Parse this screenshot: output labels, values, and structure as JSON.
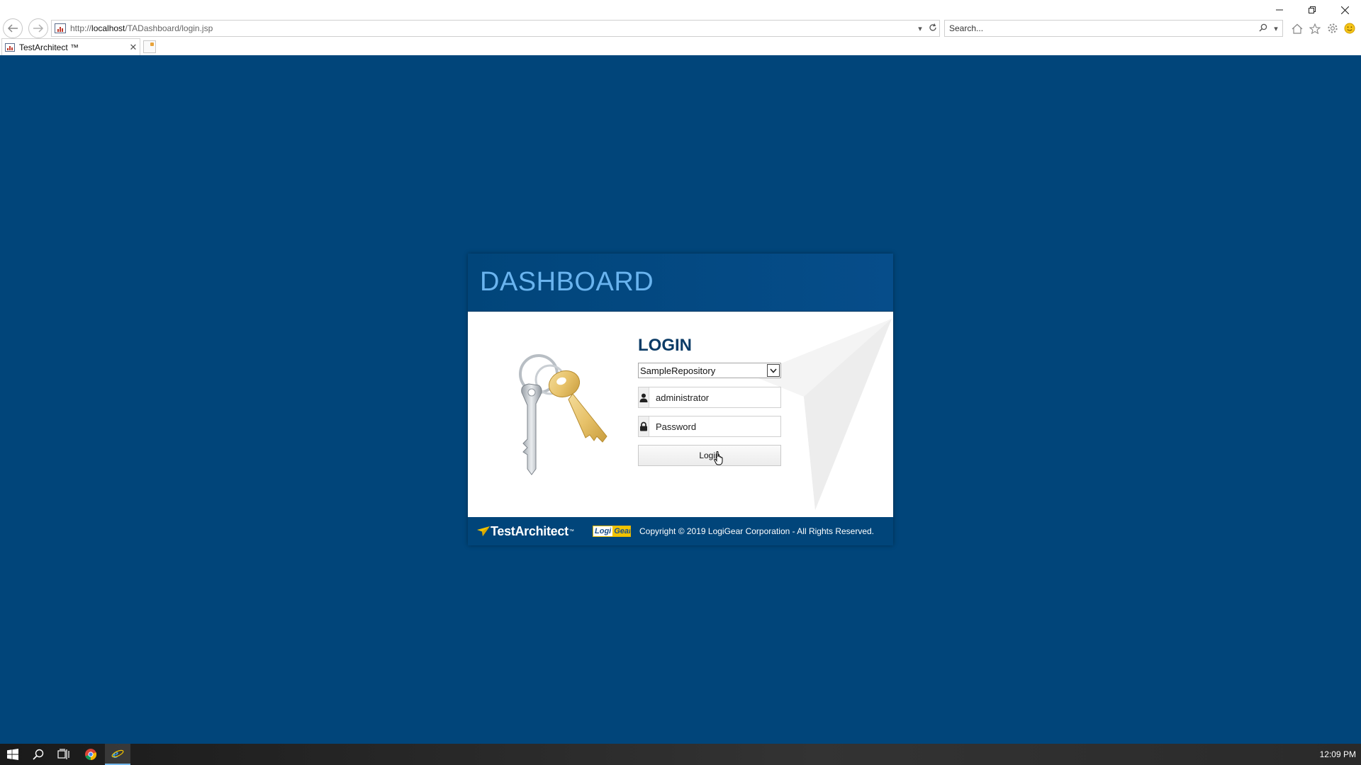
{
  "browser": {
    "url_prefix": "http://",
    "url_host": "localhost",
    "url_path": "/TADashboard/login.jsp",
    "search_placeholder": "Search...",
    "tab_title": "TestArchitect ™"
  },
  "card": {
    "header_title": "DASHBOARD",
    "login_heading": "LOGIN",
    "repository_selected": "SampleRepository",
    "username_value": "administrator",
    "password_placeholder": "Password",
    "login_button": "Login"
  },
  "footer": {
    "ta_logo_text": "TestArchitect",
    "ta_logo_tm": "™",
    "lg_logo_part1": "Logi",
    "lg_logo_part2": "Gear",
    "copyright": "Copyright © 2019 LogiGear Corporation - All Rights Reserved."
  },
  "taskbar": {
    "clock": "12:09 PM"
  },
  "colors": {
    "page_background": "#01457a",
    "header_title": "#6ab4ef",
    "login_heading": "#0b3b66",
    "logigear_yellow": "#f2c400"
  },
  "icons": {
    "back": "back-arrow-icon",
    "forward": "forward-arrow-icon",
    "refresh": "refresh-icon",
    "home": "home-icon",
    "favorites": "star-icon",
    "settings": "gear-icon",
    "feedback": "smiley-icon",
    "username": "user-icon",
    "password": "lock-icon"
  }
}
